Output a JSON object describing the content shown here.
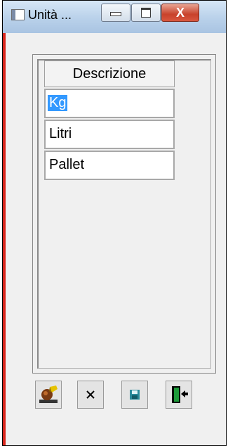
{
  "window": {
    "title": "Unità ...",
    "minimize_glyph": "minimize-icon",
    "maximize_glyph": "maximize-icon",
    "close_glyph": "X"
  },
  "grid": {
    "column_header": "Descrizione",
    "rows": [
      "Kg",
      "Litri",
      "Pallet"
    ],
    "selected_index": 0
  },
  "toolbar": {
    "buttons": [
      "edit-icon",
      "delete-icon",
      "save-icon",
      "exit-icon"
    ]
  },
  "colors": {
    "selection": "#3399ff",
    "window_border": "#d9261c"
  }
}
